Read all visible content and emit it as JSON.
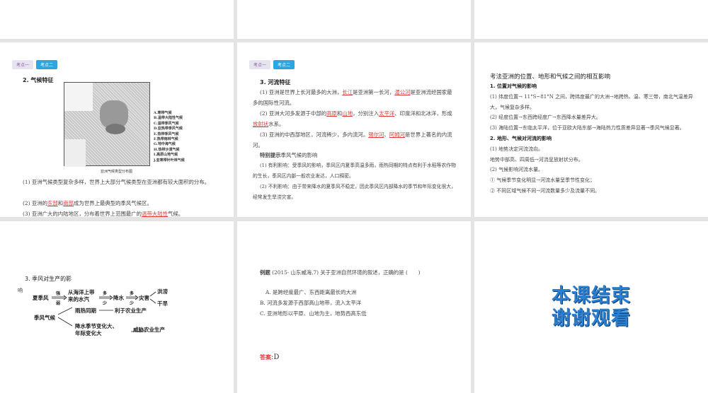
{
  "tabs": {
    "t1": "考点一",
    "t2": "考点二"
  },
  "slide_climate": {
    "heading": "2. 气候特征",
    "legend": [
      "A.寒带气候",
      "B.温带大陆性气候",
      "C.温带季风气候",
      "D.亚热带季风气候",
      "E.热带季风气候",
      "F.热带雨林气候",
      "G.地中海气候",
      "H.热带沙漠气候",
      "I.高原山地气候",
      "J.亚寒带针叶林气候"
    ],
    "map_caption": "亚洲气候类型分布图",
    "p1": "(1) 亚洲气候类型复杂多样，世界上大部分气候类型在亚洲都有较大面积的分布。",
    "p2a": "(2) 亚洲的",
    "p2r1": "东部",
    "p2b": "和",
    "p2r2": "南部",
    "p2c": "成为世界上最典型的季风气候区。",
    "p3a": "(3) 亚洲广大的内陆地区，分布着世界上范围最广的",
    "p3r": "温带大陆性",
    "p3b": "气候。"
  },
  "slide_river": {
    "heading": "3. 河流特征",
    "p1a": "(1) 亚洲是世界上长河最多的大洲，",
    "p1r1": "长江",
    "p1b": "是亚洲第一长河，",
    "p1r2": "湄公河",
    "p1c": "是亚洲流经国家最多的国际性河流。",
    "p2a": "(2) 亚洲大河多发源于中部的",
    "p2r1": "高原",
    "p2b": "和",
    "p2r2": "山地",
    "p2c": "，分别注入",
    "p2r3": "太平洋",
    "p2d": "、印度洋和北冰洋，形成",
    "p2r4": "放射状",
    "p2e": "水系。",
    "p3a": "(3) 亚洲的中西部地区，河流稀少，多内流河。",
    "p3r1": "锡尔河",
    "p3b": "、",
    "p3r2": "阿姆河",
    "p3c": "是世界上著名的内流河。",
    "tip_label": "特别提示",
    "tip_title": "季风气候的影响",
    "tip1": "(1) 有利影响：受季风的影响，季风区内夏季高温多雨，雨热同期的特点有利于水稻等农作物的生长，季风区内部一般农业发达，人口稠密。",
    "tip2": "(2) 不利影响：由于带来降水的夏季风不稳定，因此季风区内部降水的季节和年际变化很大，经常发生旱涝灾害。"
  },
  "slide_method": {
    "title": "考法亚洲的位置、地形和气候之间的相互影响",
    "s1": "1. 位置对气候的影响",
    "l1": "(1) 纬度位置→ 11°S~81°N 之间，跨纬度最广的大洲→地跨热、温、寒三带，南北气温差异大，气候复杂多样。",
    "l2": "(2) 经度位置→东西跨经度广→东西降水量差异大。",
    "l3": "(3) 海陆位置→东临太平洋，位于亚欧大陆东部→海陆热力性质差异显著→季风气候显著。",
    "s2": "2. 地形、气候对河流的影响",
    "l4": "(1) 地势决定河流流向。",
    "l5": "地势中部高、四周低→河流呈放射状分布。",
    "l6": "(2) 气候影响河流水量。",
    "l7": "① 气候季节变化明显→河流水量呈季节性变化；",
    "l8": "② 不同区域气候不同→河流数量多少及流量不同。"
  },
  "slide_monsoon": {
    "heading1": "3. 季风对生产的影",
    "heading2": "响",
    "n_summer": "夏季风",
    "n_strong": "强",
    "n_weak": "弱",
    "n_vapor1": "从海洋上带",
    "n_vapor2": "来的水汽",
    "n_more": "多",
    "n_less": "少",
    "n_rain": "降水",
    "n_disaster": "灾害",
    "n_flood": "洪涝",
    "n_drought": "干旱",
    "n_climate": "季风气候",
    "n_sync": "雨热同期",
    "n_good": "利于农业生产",
    "n_var1": "降水季节变化大、",
    "n_var2": "年际变化大",
    "n_threat": "威胁农业生产"
  },
  "slide_example": {
    "label": "例题",
    "q": "(2015· 山东威海,7) 关于亚洲自然环境的叙述，正确的是 (　　)",
    "a": "A. 是跨经度最广、东西距离最长的大洲",
    "b": "B. 河流多发源于西部高山地带，流入太平洋",
    "c": "C. 亚洲地形以平原、山地为主，地势西高东低",
    "ans_label": "答案",
    "ans": ":D"
  },
  "end": {
    "line1": "本课结束",
    "line2": "谢谢观看"
  }
}
